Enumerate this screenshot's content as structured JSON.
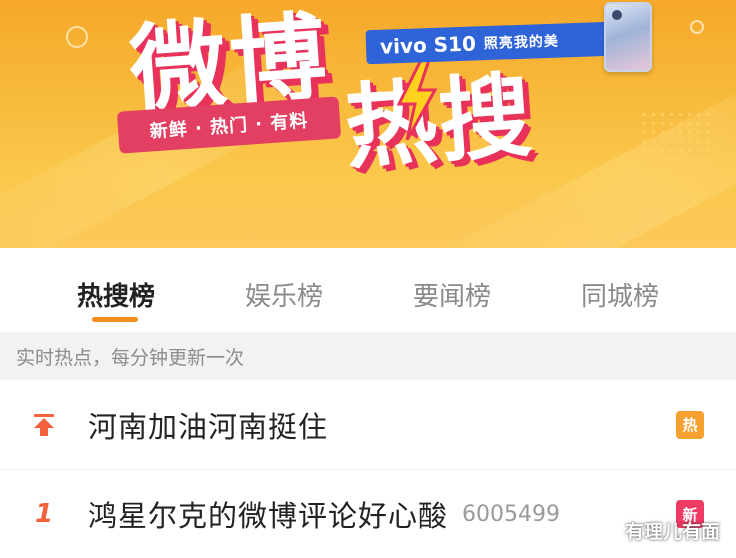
{
  "banner": {
    "title_main": "微博",
    "title_sub": "热搜",
    "slogan": "新鲜 · 热门 · 有料",
    "ad_brand": "vivo S10",
    "ad_tagline": "照亮我的美"
  },
  "tabs": [
    {
      "label": "热搜榜",
      "active": true
    },
    {
      "label": "娱乐榜",
      "active": false
    },
    {
      "label": "要闻榜",
      "active": false
    },
    {
      "label": "同城榜",
      "active": false
    }
  ],
  "subtitle": "实时热点，每分钟更新一次",
  "list": [
    {
      "rank": "",
      "rank_icon": "pin-top-icon",
      "title": "河南加油河南挺住",
      "count": "",
      "badge": "热"
    },
    {
      "rank": "1",
      "rank_icon": "",
      "title": "鸿星尔克的微博评论好心酸",
      "count": "6005499",
      "badge": "新"
    }
  ],
  "watermark": {
    "text": "有理儿有面",
    "icon": "wechat-icon"
  },
  "colors": {
    "accent": "#f58d1e",
    "rank": "#f2623c",
    "badge_hot": "#f6a12f",
    "badge_new": "#ee3a64",
    "banner_red": "#e8325a",
    "ad_blue": "#2f63d8"
  }
}
